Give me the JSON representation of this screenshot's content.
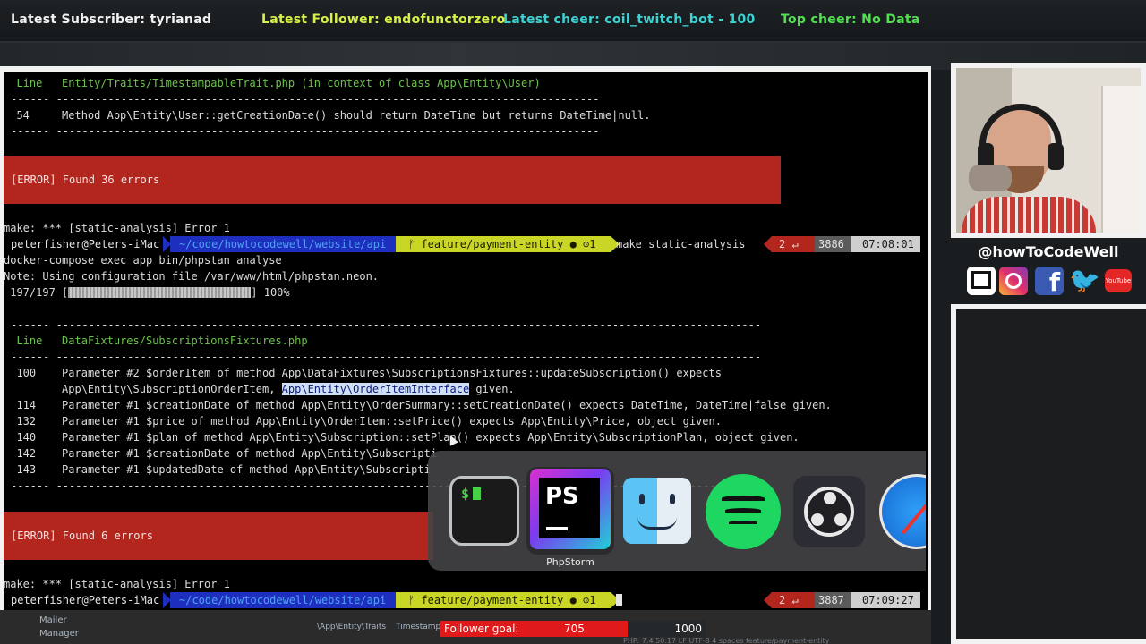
{
  "stream_bar": {
    "latest_subscriber": "Latest Subscriber: tyrianad",
    "latest_follower": "Latest Follower: endofunctorzero",
    "latest_cheer": "Latest cheer: coil_twitch_bot - 100",
    "top_cheer": "Top cheer: No Data"
  },
  "terminal": {
    "block1": {
      "header_col": "Line",
      "header_file": "Entity/Traits/TimestampableTrait.php (in context of class App\\Entity\\User)",
      "rule_short": "------",
      "rule_long": "------------------------------------------------------------------------------------",
      "rows": [
        {
          "line": "54",
          "message": "Method App\\Entity\\User::getCreationDate() should return DateTime but returns DateTime|null."
        }
      ]
    },
    "error1": "[ERROR] Found 36 errors",
    "make_error": "make: *** [static-analysis] Error 1",
    "prompt1": {
      "user": "peterfisher@Peters-iMac",
      "path": "~/code/howtocodewell/website/api",
      "branch": "ᚠ feature/payment-entity ● ⊙1",
      "command": "make static-analysis",
      "status": "2 ↵",
      "history": "3886",
      "time": "07:08:01"
    },
    "exec_line": "docker-compose exec app bin/phpstan analyse",
    "note_line": "Note: Using configuration file /var/www/html/phpstan.neon.",
    "progress": {
      "count": "197/197",
      "percent": "100%",
      "fraction": 1.0
    },
    "block2": {
      "header_col": "Line",
      "header_file": "DataFixtures/SubscriptionsFixtures.php",
      "rule_long": "-------------------------------------------------------------------------------------------------------------",
      "rows": [
        {
          "line": "100",
          "message": "Parameter #2 $orderItem of method App\\DataFixtures\\SubscriptionsFixtures::updateSubscription() expects"
        },
        {
          "line": "",
          "message_pre": "App\\Entity\\SubscriptionOrderItem, ",
          "message_sel": "App\\Entity\\OrderItemInterface",
          "message_post": " given."
        },
        {
          "line": "114",
          "message": "Parameter #1 $creationDate of method App\\Entity\\OrderSummary::setCreationDate() expects DateTime, DateTime|false given."
        },
        {
          "line": "132",
          "message": "Parameter #1 $price of method App\\Entity\\OrderItem::setPrice() expects App\\Entity\\Price, object given."
        },
        {
          "line": "140",
          "message": "Parameter #1 $plan of method App\\Entity\\Subscription::setPlan() expects App\\Entity\\SubscriptionPlan, object given."
        },
        {
          "line": "142",
          "message": "Parameter #1 $creationDate of method App\\Entity\\Subscripti"
        },
        {
          "line": "143",
          "message": "Parameter #1 $updatedDate of method App\\Entity\\Subscripti"
        }
      ]
    },
    "error2": "[ERROR] Found 6 errors",
    "make_error2": "make: *** [static-analysis] Error 1",
    "prompt2": {
      "user": "peterfisher@Peters-iMac",
      "path": "~/code/howtocodewell/website/api",
      "branch": "ᚠ feature/payment-entity ● ⊙1",
      "status": "2 ↵",
      "history": "3887",
      "time": "07:09:27"
    }
  },
  "app_switcher": {
    "selected_label": "PhpStorm",
    "apps": [
      "terminal-icon",
      "phpstorm-icon",
      "finder-icon",
      "spotify-icon",
      "obs-icon",
      "safari-icon"
    ],
    "terminal_glyph": "$"
  },
  "sidebar": {
    "handle": "@howToCodeWell",
    "socials": [
      "twitch-icon",
      "instagram-icon",
      "facebook-icon",
      "twitter-icon",
      "youtube-icon"
    ],
    "facebook_glyph": "f",
    "twitter_glyph": "🐦",
    "youtube_glyph": "YouTube"
  },
  "ide_bottom": {
    "tree_item1": "Mailer",
    "tree_item2": "Manager",
    "crumb1": "\\App\\Entity\\Traits",
    "crumb2": "Timestamp",
    "status_info": "PHP: 7.4   50:17   LF   UTF-8   4 spaces   feature/payment-entity"
  },
  "follower_goal": {
    "label": "Follower goal:",
    "current": "705",
    "target": "1000",
    "fraction": 0.705
  },
  "colors": {
    "error_bg": "#b3261e",
    "path_segment": "#1e2fbf",
    "git_segment": "#c9d626",
    "terminal_green": "#6cc44a",
    "goal_fill": "#e01a1a"
  }
}
